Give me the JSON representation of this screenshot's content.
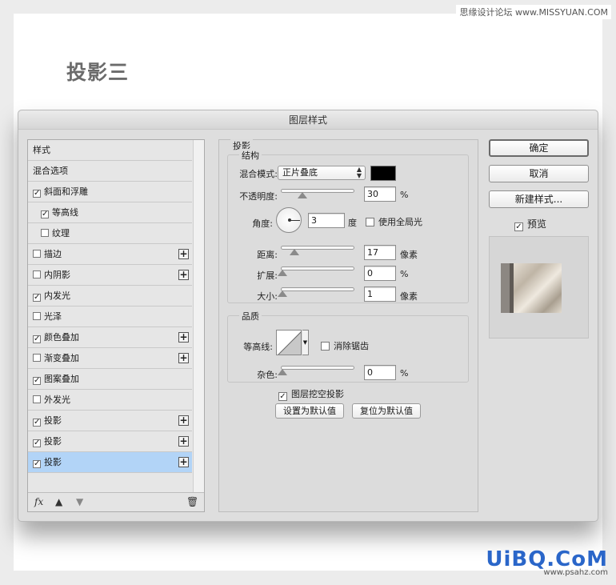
{
  "watermark_top": "思缘设计论坛 www.MISSYUAN.COM",
  "page_title": "投影三",
  "dialog": {
    "title": "图层样式",
    "style_list": [
      {
        "label": "样式",
        "checkbox": false,
        "checked": false,
        "plus": false,
        "selected": false
      },
      {
        "label": "混合选项",
        "checkbox": false,
        "checked": false,
        "plus": false,
        "selected": false
      },
      {
        "label": "斜面和浮雕",
        "checkbox": true,
        "checked": true,
        "plus": false,
        "selected": false
      },
      {
        "label": "等高线",
        "checkbox": true,
        "checked": true,
        "plus": false,
        "selected": false,
        "indent": true
      },
      {
        "label": "纹理",
        "checkbox": true,
        "checked": false,
        "plus": false,
        "selected": false,
        "indent": true
      },
      {
        "label": "描边",
        "checkbox": true,
        "checked": false,
        "plus": true,
        "selected": false
      },
      {
        "label": "内阴影",
        "checkbox": true,
        "checked": false,
        "plus": true,
        "selected": false
      },
      {
        "label": "内发光",
        "checkbox": true,
        "checked": true,
        "plus": false,
        "selected": false
      },
      {
        "label": "光泽",
        "checkbox": true,
        "checked": false,
        "plus": false,
        "selected": false
      },
      {
        "label": "颜色叠加",
        "checkbox": true,
        "checked": true,
        "plus": true,
        "selected": false
      },
      {
        "label": "渐变叠加",
        "checkbox": true,
        "checked": false,
        "plus": true,
        "selected": false
      },
      {
        "label": "图案叠加",
        "checkbox": true,
        "checked": true,
        "plus": false,
        "selected": false
      },
      {
        "label": "外发光",
        "checkbox": true,
        "checked": false,
        "plus": false,
        "selected": false
      },
      {
        "label": "投影",
        "checkbox": true,
        "checked": true,
        "plus": true,
        "selected": false
      },
      {
        "label": "投影",
        "checkbox": true,
        "checked": true,
        "plus": true,
        "selected": false
      },
      {
        "label": "投影",
        "checkbox": true,
        "checked": true,
        "plus": true,
        "selected": true
      }
    ],
    "footer": {
      "fx": "fx",
      "up_icon": "arrow-up-icon",
      "down_icon": "arrow-down-icon",
      "trash_icon": "trash-icon"
    },
    "panel": {
      "section_title": "投影",
      "structure_title": "结构",
      "blend_mode_label": "混合模式:",
      "blend_mode_value": "正片叠底",
      "swatch_color": "#000000",
      "opacity_label": "不透明度:",
      "opacity_value": "30",
      "opacity_unit": "%",
      "opacity_level": 0.3,
      "angle_label": "角度:",
      "angle_value": "3",
      "angle_unit": "度",
      "global_light_label": "使用全局光",
      "global_light_checked": false,
      "distance_label": "距离:",
      "distance_value": "17",
      "distance_unit": "像素",
      "spread_label": "扩展:",
      "spread_value": "0",
      "spread_unit": "%",
      "size_label": "大小:",
      "size_value": "1",
      "size_unit": "像素",
      "quality_title": "品质",
      "contour_label": "等高线:",
      "antialias_label": "消除锯齿",
      "antialias_checked": false,
      "noise_label": "杂色:",
      "noise_value": "0",
      "noise_unit": "%",
      "knockout_label": "图层挖空投影",
      "knockout_checked": true,
      "make_default_label": "设置为默认值",
      "reset_default_label": "复位为默认值"
    },
    "buttons": {
      "ok": "确定",
      "cancel": "取消",
      "new_style": "新建样式...",
      "preview_label": "预览",
      "preview_checked": true
    }
  },
  "watermark_bottom": {
    "logo": "UiBQ.CoM",
    "url": "www.psahz.com"
  }
}
